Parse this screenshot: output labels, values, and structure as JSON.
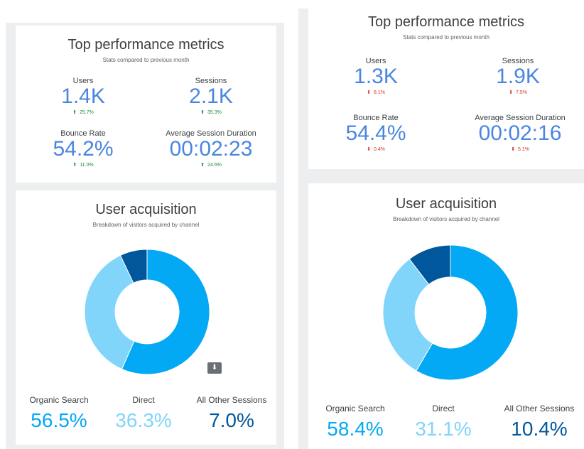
{
  "colors": {
    "metric_value": "#4a86e0",
    "change_up": "#1e8e3e",
    "change_down": "#d93025",
    "organic_search": "#03a9f4",
    "direct": "#81d4fa",
    "other_sessions": "#01579b"
  },
  "left": {
    "metrics": {
      "title": "Top performance metrics",
      "subtitle": "Stats compared to previous month",
      "users": {
        "label": "Users",
        "value": "1.4K",
        "change": "25.7%",
        "direction": "up"
      },
      "sessions": {
        "label": "Sessions",
        "value": "2.1K",
        "change": "35.3%",
        "direction": "up"
      },
      "bounce": {
        "label": "Bounce Rate",
        "value": "54.2%",
        "change": "11.0%",
        "direction": "up"
      },
      "duration": {
        "label": "Average Session Duration",
        "value": "00:02:23",
        "change": "24.6%",
        "direction": "up"
      }
    },
    "acquisition": {
      "title": "User acquisition",
      "subtitle": "Breakdown of visitors acquired by channel",
      "download_icon": "download-icon",
      "channels": [
        {
          "label": "Organic Search",
          "value": "56.5%"
        },
        {
          "label": "Direct",
          "value": "36.3%"
        },
        {
          "label": "All Other Sessions",
          "value": "7.0%"
        }
      ]
    }
  },
  "right": {
    "metrics": {
      "title": "Top performance metrics",
      "subtitle": "Stats compared to previous month",
      "users": {
        "label": "Users",
        "value": "1.3K",
        "change": "8.1%",
        "direction": "down"
      },
      "sessions": {
        "label": "Sessions",
        "value": "1.9K",
        "change": "7.5%",
        "direction": "down"
      },
      "bounce": {
        "label": "Bounce Rate",
        "value": "54.4%",
        "change": "0.4%",
        "direction": "down"
      },
      "duration": {
        "label": "Average Session Duration",
        "value": "00:02:16",
        "change": "5.1%",
        "direction": "down"
      }
    },
    "acquisition": {
      "title": "User acquisition",
      "subtitle": "Breakdown of visitors acquired by channel",
      "channels": [
        {
          "label": "Organic Search",
          "value": "58.4%"
        },
        {
          "label": "Direct",
          "value": "31.1%"
        },
        {
          "label": "All Other Sessions",
          "value": "10.4%"
        }
      ]
    }
  }
}
